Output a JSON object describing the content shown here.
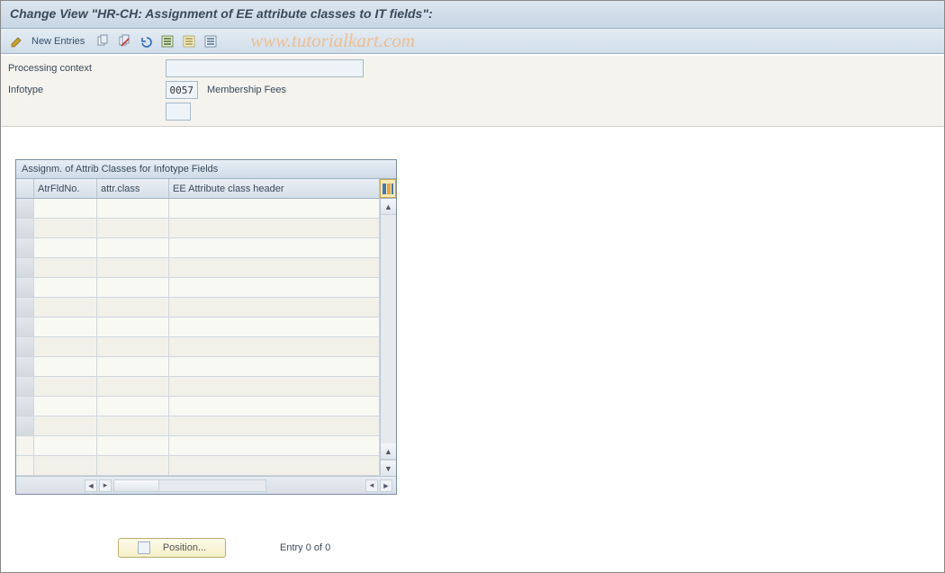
{
  "header": {
    "title": "Change View \"HR-CH: Assignment of EE attribute classes to IT fields\":"
  },
  "toolbar": {
    "new_entries_label": "New Entries",
    "icons": [
      "pencil-icon",
      "copy-icon",
      "delete-icon",
      "undo-icon",
      "select-all-icon",
      "select-block-icon",
      "deselect-all-icon"
    ]
  },
  "watermark": "www.tutorialkart.com",
  "form": {
    "processing_context": {
      "label": "Processing context",
      "value": ""
    },
    "infotype": {
      "label": "Infotype",
      "value": "0057",
      "text": "Membership Fees"
    },
    "extra": {
      "value": ""
    }
  },
  "grid": {
    "title": "Assignm. of Attrib Classes for Infotype Fields",
    "columns": {
      "atr_fld_no": "AtrFldNo.",
      "attr_class": "attr.class",
      "ee_header": "EE Attribute class header"
    },
    "rows": [
      {},
      {},
      {},
      {},
      {},
      {},
      {},
      {},
      {},
      {},
      {},
      {},
      {},
      {}
    ],
    "filled_row_count": 12
  },
  "footer": {
    "position_label": "Position...",
    "entry_text": "Entry 0 of 0"
  }
}
